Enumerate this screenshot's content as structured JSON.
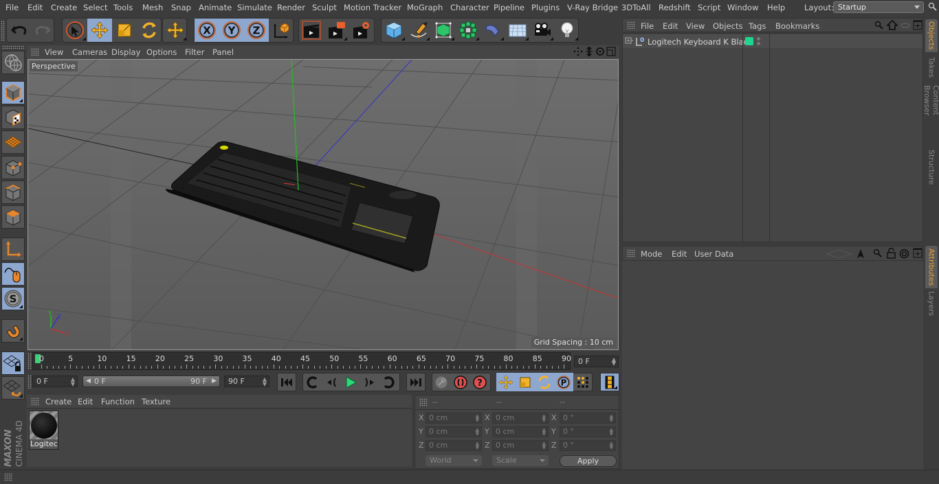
{
  "menubar": {
    "items": [
      "File",
      "Edit",
      "Create",
      "Select",
      "Tools",
      "Mesh",
      "Snap",
      "Animate",
      "Simulate",
      "Render",
      "Sculpt",
      "Motion Tracker",
      "MoGraph",
      "Character",
      "Pipeline",
      "Plugins",
      "V-Ray Bridge",
      "3DToAll",
      "Redshift",
      "Script",
      "Window",
      "Help"
    ],
    "layout_label": "Layout:",
    "layout_value": "Startup"
  },
  "toolbar": {
    "icons": [
      "undo-icon",
      "redo-icon",
      "live-selection-icon",
      "move-icon",
      "scale-icon",
      "rotate-icon",
      "recent-tool-move-icon",
      "x-axis-lock-icon",
      "y-axis-lock-icon",
      "z-axis-lock-icon",
      "coordinate-system-icon",
      "render-view-icon",
      "render-to-picture-viewer-icon",
      "render-settings-icon",
      "cube-primitive-icon",
      "pen-spline-icon",
      "subdivision-surface-icon",
      "cloner-icon",
      "deformer-bend-icon",
      "floor-scene-icon",
      "camera-icon",
      "light-icon"
    ]
  },
  "left_toolbar": {
    "icons": [
      "make-editable-icon",
      "model-mode-icon",
      "texture-mode-icon",
      "workplane-mode-icon",
      "points-mode-icon",
      "edges-mode-icon",
      "polygons-mode-icon",
      "axis-mode-icon",
      "tweak-mode-icon",
      "solo-icon",
      "snap-magnet-icon",
      "lock-workplane-icon",
      "workplane-align-icon"
    ]
  },
  "viewport": {
    "menu": [
      "View",
      "Cameras",
      "Display",
      "Options",
      "Filter",
      "Panel"
    ],
    "camera_label": "Perspective",
    "grid_spacing": "Grid Spacing : 10 cm",
    "axis_labels": {
      "x": "X",
      "y": "Y",
      "z": "Z"
    }
  },
  "timeline": {
    "ticks": [
      "0",
      "5",
      "10",
      "15",
      "20",
      "25",
      "30",
      "35",
      "40",
      "45",
      "50",
      "55",
      "60",
      "65",
      "70",
      "75",
      "80",
      "85",
      "90"
    ],
    "current_frame": "0 F",
    "start_field": "0 F",
    "range_start": "0 F",
    "range_end": "90 F",
    "end_field": "90 F"
  },
  "materials": {
    "menu": [
      "Create",
      "Edit",
      "Function",
      "Texture"
    ],
    "items": [
      {
        "name": "Logitech"
      }
    ]
  },
  "coordinates": {
    "headers": [
      "--",
      "--",
      "--"
    ],
    "rows": [
      {
        "axis": "X",
        "pos": "0 cm",
        "size": "0 cm",
        "rot": "0 °"
      },
      {
        "axis": "Y",
        "pos": "0 cm",
        "size": "0 cm",
        "rot": "0 °"
      },
      {
        "axis": "Z",
        "pos": "0 cm",
        "size": "0 cm",
        "rot": "0 °"
      }
    ],
    "mode_dropdown": "World",
    "size_dropdown": "Scale",
    "apply_label": "Apply"
  },
  "objects_panel": {
    "menu": [
      "File",
      "Edit",
      "View",
      "Objects",
      "Tags",
      "Bookmarks"
    ],
    "items": [
      {
        "name": "Logitech Keyboard K Black",
        "layer_color": "#1fd68f"
      }
    ]
  },
  "attributes_panel": {
    "menu": [
      "Mode",
      "Edit",
      "User Data"
    ]
  },
  "right_tabs": {
    "top": [
      "Objects",
      "Takes",
      "Content Browser",
      "Structure"
    ],
    "bottom": [
      "Attributes",
      "Layers"
    ]
  },
  "branding": {
    "maxon": "MAXON",
    "product": "CINEMA 4D"
  },
  "colors": {
    "accent_active": "#8ea7cf",
    "tab_active": "#e8a23b",
    "axis_x": "#c83232",
    "axis_y": "#32b432",
    "axis_z": "#3232c8"
  }
}
